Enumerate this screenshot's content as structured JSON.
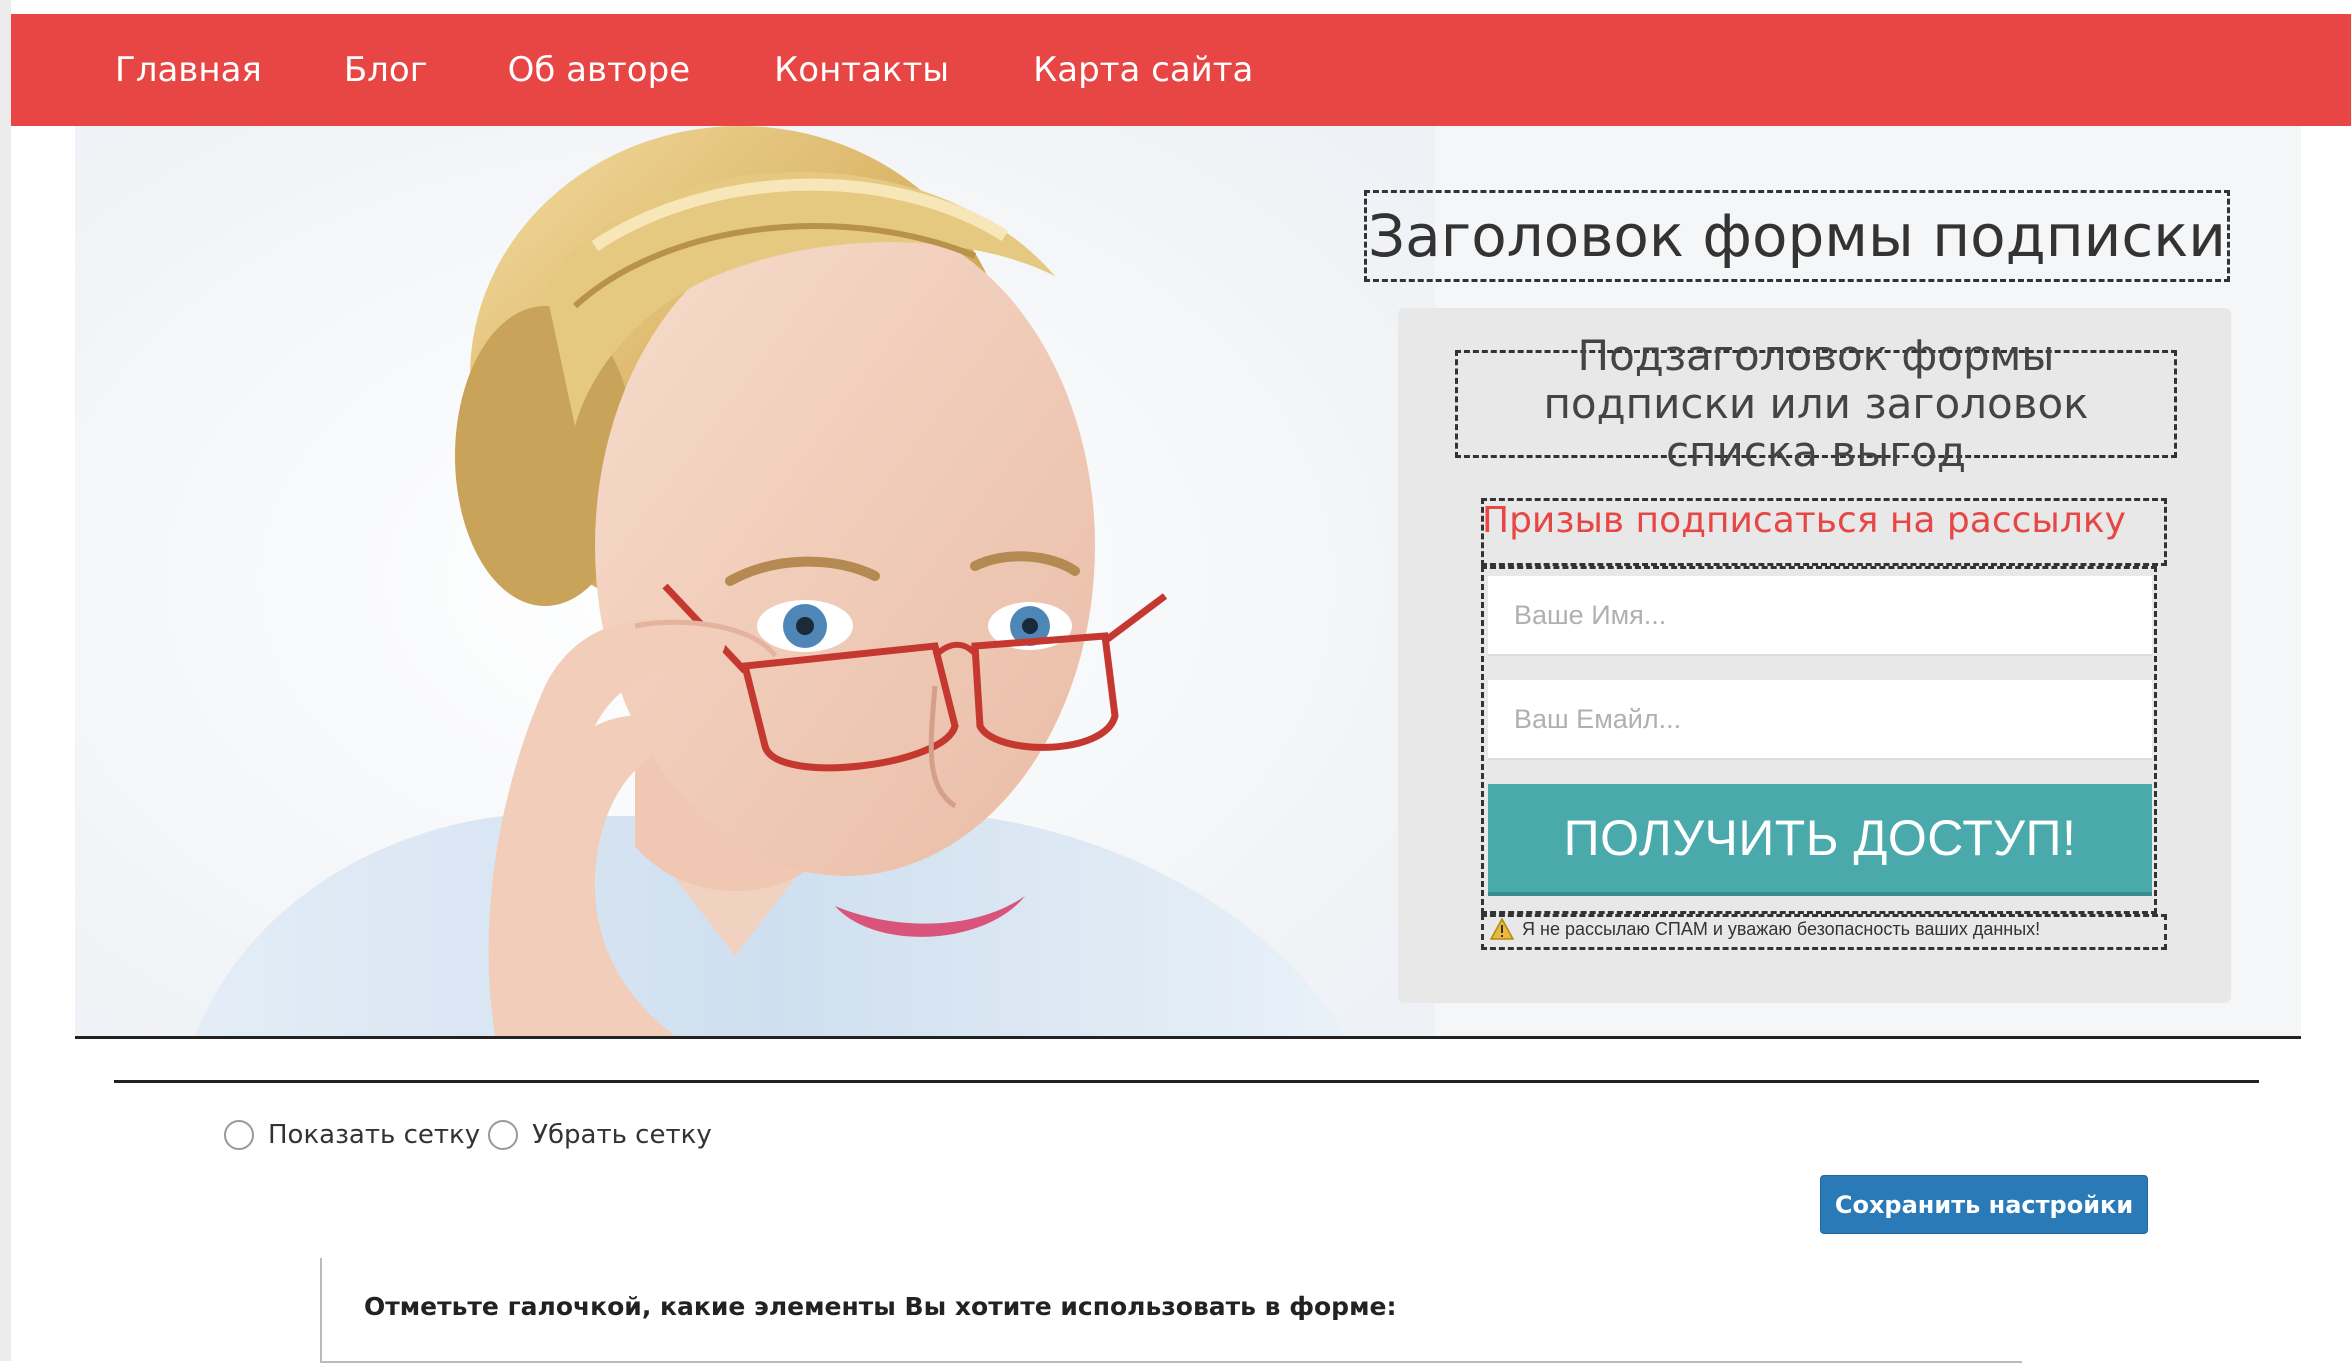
{
  "nav": {
    "items": [
      {
        "label": "Главная"
      },
      {
        "label": "Блог"
      },
      {
        "label": "Об авторе"
      },
      {
        "label": "Контакты"
      },
      {
        "label": "Карта сайта"
      }
    ],
    "background_color": "#e84545"
  },
  "form": {
    "headline": "Заголовок формы подписки",
    "subheadline": "Подзаголовок формы подписки или заголовок списка выгод",
    "call_to_action": "Призыв подписаться на рассылку",
    "name_placeholder": "Ваше Имя...",
    "email_placeholder": "Ваш Емайл...",
    "submit_label": "ПОЛУЧИТЬ ДОСТУП!",
    "privacy_note": "Я не рассылаю СПАМ и уважаю безопасность ваших данных!",
    "accent_color": "#e84545",
    "button_color": "#4aa9ab"
  },
  "grid_options": {
    "show_label": "Показать сетку",
    "hide_label": "Убрать сетку"
  },
  "save_button": {
    "label": "Сохранить настройки",
    "color": "#2b7ab8"
  },
  "settings": {
    "title": "Отметьте галочкой, какие элементы Вы хотите использовать в форме:"
  },
  "icons": {
    "privacy": "warning-icon",
    "radio": "radio-button"
  }
}
